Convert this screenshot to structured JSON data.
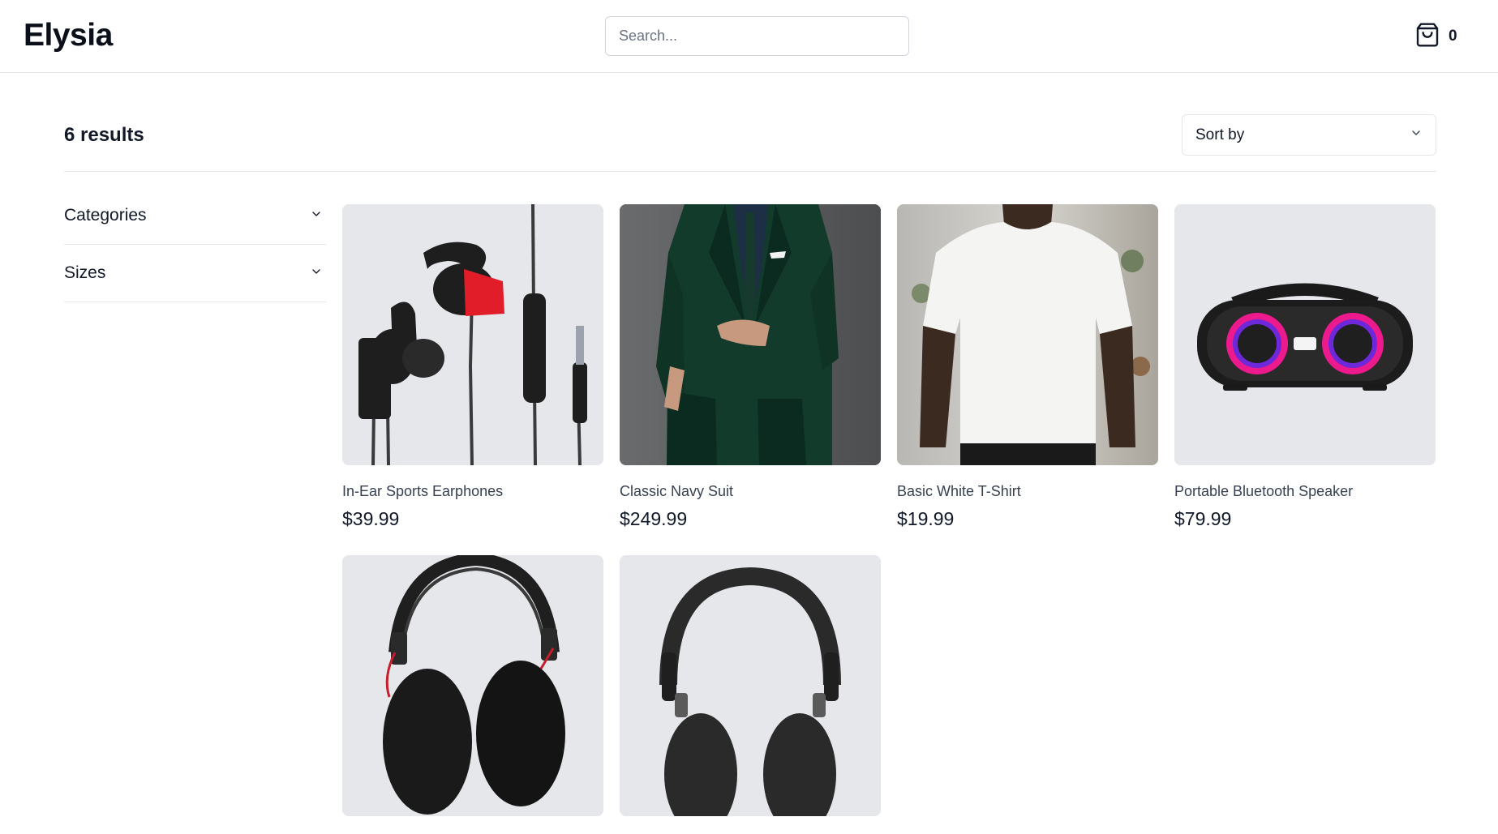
{
  "header": {
    "logo": "Elysia",
    "search_placeholder": "Search...",
    "cart_count": "0"
  },
  "toolbar": {
    "results": "6 results",
    "sort_label": "Sort by"
  },
  "filters": [
    {
      "label": "Categories"
    },
    {
      "label": "Sizes"
    }
  ],
  "products": [
    {
      "name": "In-Ear Sports Earphones",
      "price": "$39.99",
      "image": "earphones-image"
    },
    {
      "name": "Classic Navy Suit",
      "price": "$249.99",
      "image": "suit-image"
    },
    {
      "name": "Basic White T-Shirt",
      "price": "$19.99",
      "image": "tshirt-image"
    },
    {
      "name": "Portable Bluetooth Speaker",
      "price": "$79.99",
      "image": "speaker-image"
    },
    {
      "name": "",
      "price": "",
      "image": "headphones-red-image"
    },
    {
      "name": "",
      "price": "",
      "image": "headphones-black-image"
    }
  ],
  "colors": {
    "border": "#e5e7eb",
    "image_bg": "#e5e7eb",
    "text": "#111827",
    "muted_text": "#374151"
  }
}
